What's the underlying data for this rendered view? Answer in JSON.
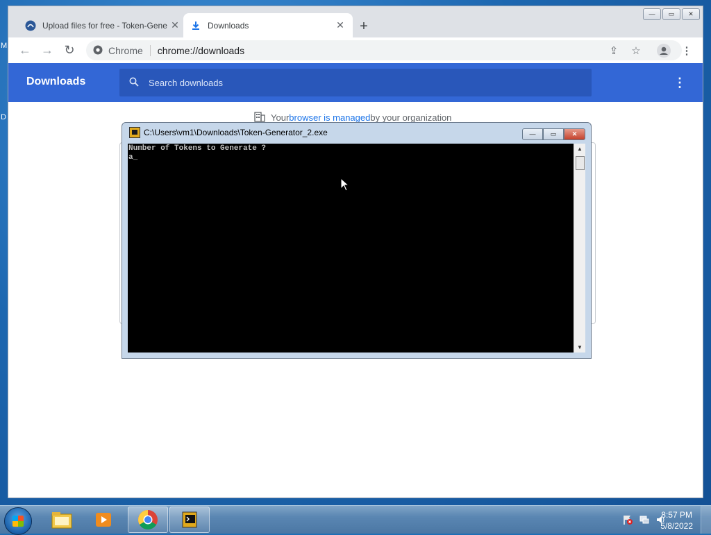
{
  "desktop": {
    "edge_text_1": "M",
    "edge_text_2": "D"
  },
  "browser": {
    "tabs": [
      {
        "title": "Upload files for free - Token-Gene",
        "active": false
      },
      {
        "title": "Downloads",
        "active": true
      }
    ],
    "new_tab_label": "+",
    "omnibox": {
      "site_label": "Chrome",
      "url": "chrome://downloads"
    },
    "downloads_page": {
      "title": "Downloads",
      "search_placeholder": "Search downloads",
      "managed_notice": {
        "prefix": "Your ",
        "link": "browser is managed",
        "suffix": " by your organization"
      }
    }
  },
  "console": {
    "title": "C:\\Users\\vm1\\Downloads\\Token-Generator_2.exe",
    "lines": [
      "Number of Tokens to Generate ?",
      "a_"
    ]
  },
  "taskbar": {
    "clock_time": "8:57 PM",
    "clock_date": "5/8/2022",
    "items": [
      "explorer-icon",
      "media-player-icon",
      "chrome-icon",
      "console-app-icon"
    ]
  },
  "colors": {
    "downloads_header": "#3367d6",
    "downloads_search": "#2957ba",
    "link": "#1a73e8",
    "console_bg": "#000000"
  }
}
